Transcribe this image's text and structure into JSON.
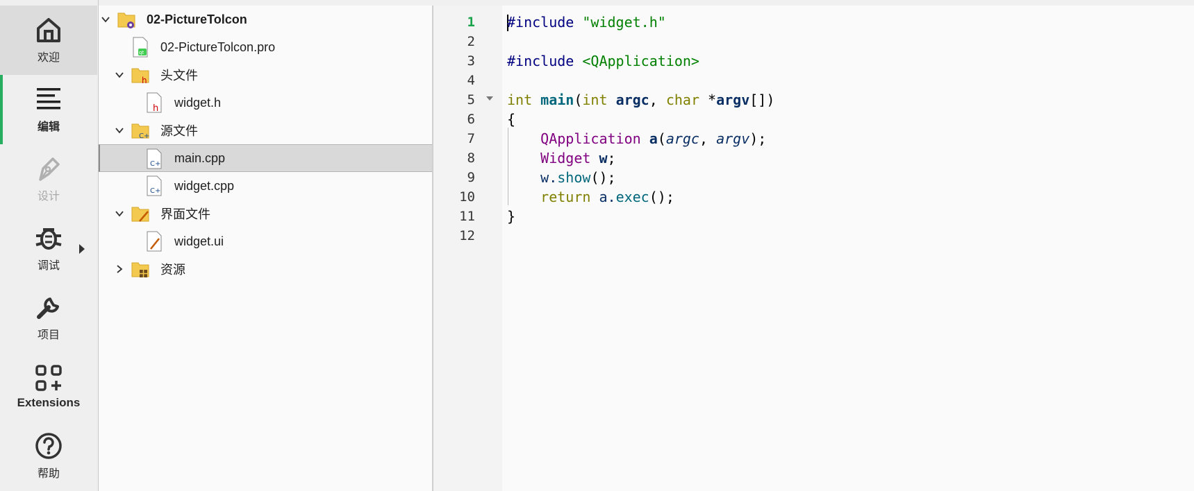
{
  "modes": [
    {
      "label": "欢迎",
      "icon": "home-icon"
    },
    {
      "label": "编辑",
      "icon": "edit-lines-icon"
    },
    {
      "label": "设计",
      "icon": "pen-nib-icon"
    },
    {
      "label": "调试",
      "icon": "bug-icon"
    },
    {
      "label": "项目",
      "icon": "wrench-icon"
    },
    {
      "label": "Extensions",
      "icon": "extensions-grid-icon"
    },
    {
      "label": "帮助",
      "icon": "help-icon"
    }
  ],
  "tree": {
    "root": "02-PictureTolcon",
    "pro_file": "02-PictureTolcon.pro",
    "headers": "头文件",
    "header_files": [
      "widget.h"
    ],
    "sources": "源文件",
    "source_files": [
      "main.cpp",
      "widget.cpp"
    ],
    "forms": "界面文件",
    "form_files": [
      "widget.ui"
    ],
    "resources": "资源",
    "selected": "main.cpp"
  },
  "editor": {
    "line_numbers": [
      "1",
      "2",
      "3",
      "4",
      "5",
      "6",
      "7",
      "8",
      "9",
      "10",
      "11",
      "12"
    ],
    "current_line": "1",
    "code": {
      "l1_directive": "#include",
      "l1_arg": "\"widget.h\"",
      "l3_directive": "#include",
      "l3_arg": "<QApplication>",
      "l5_int": "int",
      "l5_main": "main",
      "l5_open": "(",
      "l5_int2": "int",
      "l5_argc": "argc",
      "l5_comma": ", ",
      "l5_char": "char",
      "l5_star": " *",
      "l5_argv": "argv",
      "l5_close": "[])",
      "l6": "{",
      "l7_type": "QApplication",
      "l7_var": "a",
      "l7_open": "(",
      "l7_argc": "argc",
      "l7_comma": ", ",
      "l7_argv": "argv",
      "l7_close": ");",
      "l8_type": "Widget",
      "l8_var": "w",
      "l8_semi": ";",
      "l9_obj": "w.",
      "l9_fn": "show",
      "l9_rest": "();",
      "l10_ret": "return",
      "l10_obj": "a.",
      "l10_fn": "exec",
      "l10_rest": "();",
      "l11": "}"
    }
  }
}
